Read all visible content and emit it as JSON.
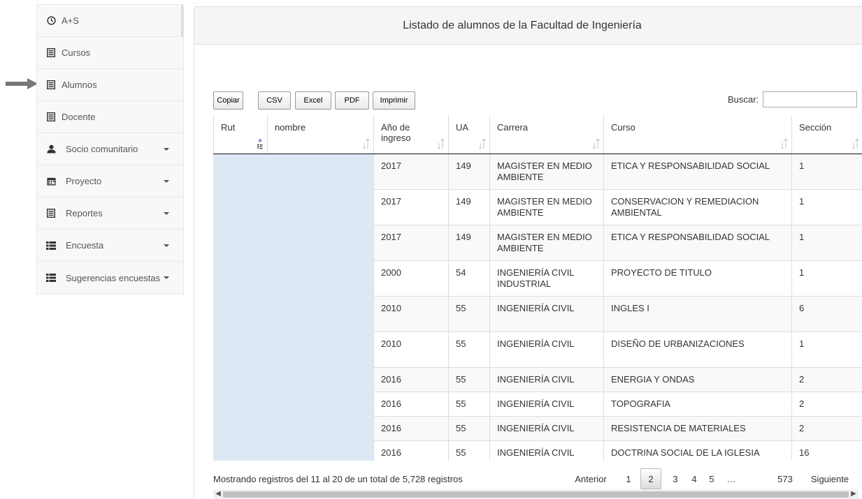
{
  "sidebar": {
    "items": [
      {
        "label": "A+S",
        "icon": "dashboard-icon",
        "caret": false
      },
      {
        "label": "Cursos",
        "icon": "list-alt-icon",
        "caret": false
      },
      {
        "label": "Alumnos",
        "icon": "list-alt-icon",
        "caret": false
      },
      {
        "label": "Docente",
        "icon": "list-alt-icon",
        "caret": false
      },
      {
        "label": "Socio comunitario",
        "icon": "user-icon",
        "caret": true
      },
      {
        "label": "Proyecto",
        "icon": "calendar-icon",
        "caret": true
      },
      {
        "label": "Reportes",
        "icon": "list-alt-icon",
        "caret": true
      },
      {
        "label": "Encuesta",
        "icon": "th-list-icon",
        "caret": true
      },
      {
        "label": "Sugerencias encuestas",
        "icon": "th-list-icon",
        "caret": true
      }
    ]
  },
  "panel": {
    "title": "Listado de alumnos de la Facultad de Ingeniería"
  },
  "toolbar": {
    "copy": "Copiar",
    "csv": "CSV",
    "excel": "Excel",
    "pdf": "PDF",
    "print": "Imprimir",
    "search_label": "Buscar:",
    "search_value": ""
  },
  "table": {
    "columns": [
      "Rut",
      "nombre",
      "Año de ingreso",
      "UA",
      "Carrera",
      "Curso",
      "Sección"
    ],
    "rows": [
      {
        "rut": "",
        "nombre": "",
        "anio": "2017",
        "ua": "149",
        "carrera": "MAGISTER EN MEDIO AMBIENTE",
        "curso": "ETICA Y RESPONSABILIDAD SOCIAL",
        "seccion": "1"
      },
      {
        "rut": "",
        "nombre": "",
        "anio": "2017",
        "ua": "149",
        "carrera": "MAGISTER EN MEDIO AMBIENTE",
        "curso": "CONSERVACION Y REMEDIACION AMBIENTAL",
        "seccion": "1"
      },
      {
        "rut": "",
        "nombre": "",
        "anio": "2017",
        "ua": "149",
        "carrera": "MAGISTER EN MEDIO AMBIENTE",
        "curso": "ETICA Y RESPONSABILIDAD SOCIAL",
        "seccion": "1"
      },
      {
        "rut": "",
        "nombre": "",
        "anio": "2000",
        "ua": "54",
        "carrera": "INGENIERÍA CIVIL INDUSTRIAL",
        "curso": "PROYECTO DE TITULO",
        "seccion": "1"
      },
      {
        "rut": "",
        "nombre": "",
        "anio": "2010",
        "ua": "55",
        "carrera": "INGENIERÍA CIVIL",
        "curso": "INGLES I",
        "seccion": "6"
      },
      {
        "rut": "",
        "nombre": "",
        "anio": "2010",
        "ua": "55",
        "carrera": "INGENIERÍA CIVIL",
        "curso": "DISEÑO DE URBANIZACIONES",
        "seccion": "1"
      },
      {
        "rut": "",
        "nombre": "",
        "anio": "2016",
        "ua": "55",
        "carrera": "INGENIERÍA CIVIL",
        "curso": "ENERGIA Y ONDAS",
        "seccion": "2"
      },
      {
        "rut": "",
        "nombre": "",
        "anio": "2016",
        "ua": "55",
        "carrera": "INGENIERÍA CIVIL",
        "curso": "TOPOGRAFIA",
        "seccion": "2"
      },
      {
        "rut": "",
        "nombre": "",
        "anio": "2016",
        "ua": "55",
        "carrera": "INGENIERÍA CIVIL",
        "curso": "RESISTENCIA DE MATERIALES",
        "seccion": "2"
      },
      {
        "rut": "",
        "nombre": "",
        "anio": "2016",
        "ua": "55",
        "carrera": "INGENIERÍA CIVIL",
        "curso": "DOCTRINA SOCIAL DE LA IGLESIA",
        "seccion": "16"
      }
    ]
  },
  "footer": {
    "info": "Mostrando registros del 11 al 20 de un total de 5,728 registros",
    "prev": "Anterior",
    "pages": [
      "1",
      "2",
      "3",
      "4",
      "5",
      "…",
      "573"
    ],
    "current_page": "2",
    "next": "Siguiente"
  },
  "colors": {
    "masked_cells": "#dde8f5",
    "sort_active": "#7b8fd6"
  }
}
